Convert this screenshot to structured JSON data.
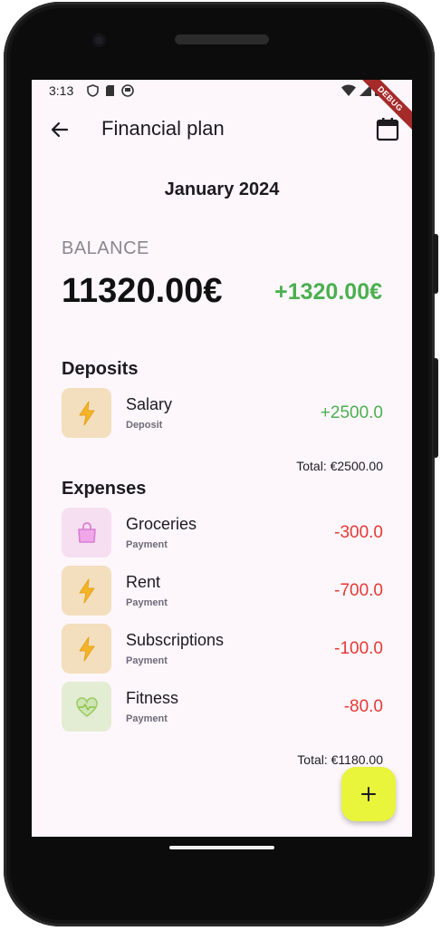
{
  "status_bar": {
    "time": "3:13",
    "debug_banner": "DEBUG"
  },
  "app_bar": {
    "title": "Financial plan"
  },
  "month": "January 2024",
  "balance": {
    "label": "BALANCE",
    "amount": "11320.00€",
    "delta": "+1320.00€"
  },
  "deposits": {
    "title": "Deposits",
    "items": [
      {
        "name": "Salary",
        "type": "Deposit",
        "amount": "+2500.0",
        "icon": "lightning-icon",
        "icon_bg": "#f3dfbd",
        "icon_color": "#f5b427"
      }
    ],
    "total": "Total: €2500.00"
  },
  "expenses": {
    "title": "Expenses",
    "items": [
      {
        "name": "Groceries",
        "type": "Payment",
        "amount": "-300.0",
        "icon": "shopping-bag-icon",
        "icon_bg": "#f6dff0",
        "icon_color": "#d77ed3"
      },
      {
        "name": "Rent",
        "type": "Payment",
        "amount": "-700.0",
        "icon": "lightning-icon",
        "icon_bg": "#f3dfbd",
        "icon_color": "#f5b427"
      },
      {
        "name": "Subscriptions",
        "type": "Payment",
        "amount": "-100.0",
        "icon": "lightning-icon",
        "icon_bg": "#f3dfbd",
        "icon_color": "#f5b427"
      },
      {
        "name": "Fitness",
        "type": "Payment",
        "amount": "-80.0",
        "icon": "heart-pulse-icon",
        "icon_bg": "#e3edd3",
        "icon_color": "#9ccc65"
      }
    ],
    "total": "Total: €1180.00"
  },
  "colors": {
    "positive": "#4caf50",
    "negative": "#e53935",
    "fab": "#e8f53a",
    "background": "#fdf7fc"
  }
}
